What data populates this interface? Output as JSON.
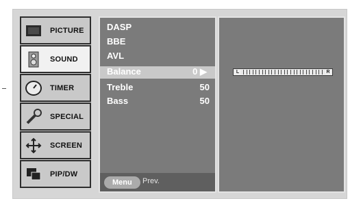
{
  "sidebar": {
    "items": [
      {
        "label": "PICTURE",
        "icon": "tv-screen-icon",
        "active": false
      },
      {
        "label": "SOUND",
        "icon": "speaker-icon",
        "active": true
      },
      {
        "label": "TIMER",
        "icon": "clock-icon",
        "active": false
      },
      {
        "label": "SPECIAL",
        "icon": "wrench-icon",
        "active": false
      },
      {
        "label": "SCREEN",
        "icon": "move-arrows-icon",
        "active": false
      },
      {
        "label": "PIP/DW",
        "icon": "pip-windows-icon",
        "active": false
      }
    ]
  },
  "menu": {
    "rows": [
      {
        "name": "DASP",
        "value": ""
      },
      {
        "name": "BBE",
        "value": ""
      },
      {
        "name": "AVL",
        "value": ""
      },
      {
        "name": "Balance",
        "value": "0 ▶",
        "selected": true
      },
      {
        "name": "Treble",
        "value": "50"
      },
      {
        "name": "Bass",
        "value": "50"
      }
    ],
    "menu_button": "Menu",
    "prev_label": "Prev."
  },
  "balance_bar": {
    "left_label": "L",
    "right_label": "R",
    "value": 0
  },
  "colors": {
    "panel_bg": "#d6d6d6",
    "menu_bg": "#7b7b7b",
    "selected_row": "#c9c9c9",
    "text": "#ffffff"
  }
}
